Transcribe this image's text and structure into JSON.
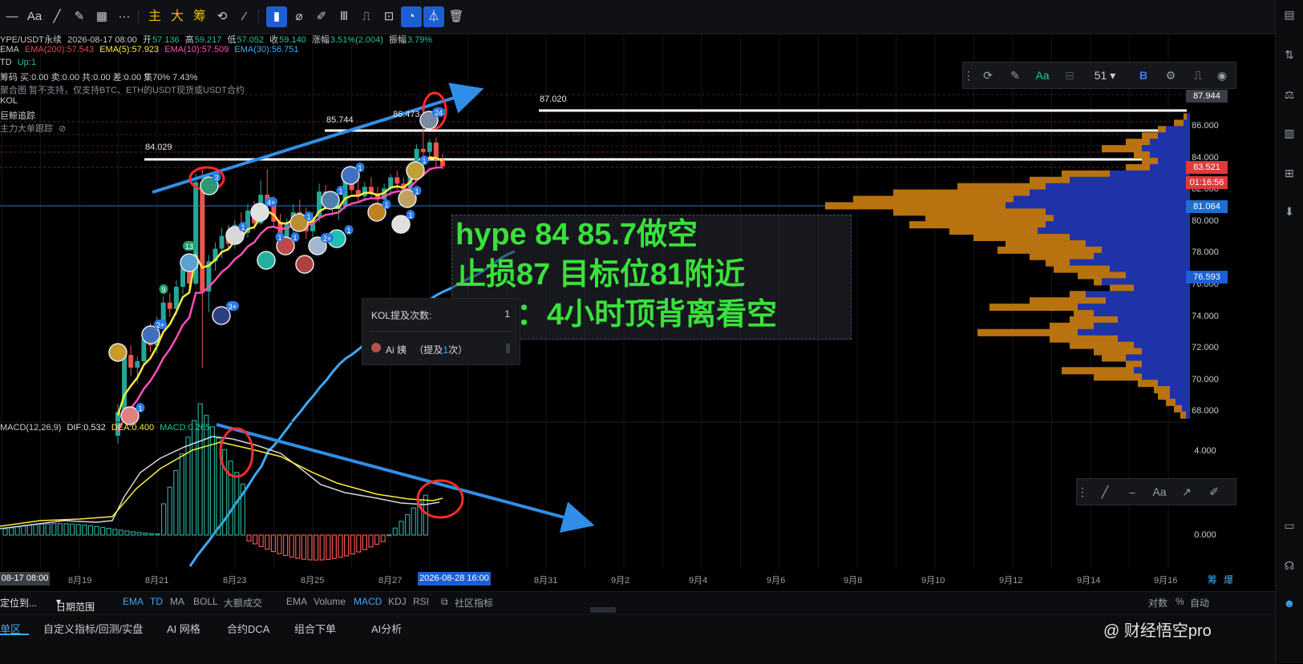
{
  "toolbar": {
    "items": [
      "一一",
      "Aa",
      "／",
      "✎",
      "▦",
      "···",
      "主",
      "大",
      "筹",
      "⟲",
      "⁄",
      "▮",
      "⌀",
      "✐",
      "Ⅲ",
      "⎍",
      "⊡",
      "◔",
      "⏃",
      "🗑"
    ],
    "text_aa": "Aa",
    "text_zhu": "主",
    "text_da": "大",
    "text_chou": "筹"
  },
  "legend": {
    "symbol": "YPE/USDT永续",
    "datetime": "2026-08-17 08:00",
    "open_label": "开",
    "open": "57.136",
    "high_label": "高",
    "high": "59.217",
    "low_label": "低",
    "low": "57.052",
    "close_label": "收",
    "close": "59.140",
    "change_label": "涨幅",
    "change": "3.51%(2.004)",
    "amp_label": "振幅",
    "amp": "3.79%",
    "ema_title": "EMA",
    "ema200": "EMA(200):57.543",
    "ema5": "EMA(5):57.923",
    "ema10": "EMA(10):57.509",
    "ema30": "EMA(30):56.751",
    "td_title": "TD",
    "td_value": "Up:1",
    "chip_line": "筹码 买:0.00 卖:0.00 共:0.00 差:0.00 集70% 7.43%",
    "chip_buy": "0.00",
    "chip_sell": "0.00",
    "chip_total": "0.00",
    "chip_diff": "0.00",
    "chip_conc": "7.43%",
    "merge_note": "聚合图 暂不支持，仅支持BTC、ETH的USDT现货或USDT合约",
    "kol": "KOL",
    "whale": "巨鲸追踪",
    "bigorder": "主力大单跟踪"
  },
  "chart_labels": {
    "l1": "84.029",
    "l2": "85.744",
    "l3": "87.020",
    "l4": "86.473"
  },
  "badges": [
    "3",
    "13",
    "9",
    "2+",
    "1",
    "1",
    "4+",
    "1",
    "1",
    "1",
    "2+",
    "1",
    "1",
    "1",
    "1",
    "1",
    "1",
    "1",
    "24",
    "3+"
  ],
  "annotation": {
    "line1": "hype 84  85.7做空",
    "line2": "止损87   目标位81附近",
    "line3": "理由：4小时顶背离看空"
  },
  "kol_popup": {
    "title": "KOL提及次数:",
    "count": "1",
    "user": "Ai 姨",
    "detail_prefix": "（提及",
    "detail_num": "1",
    "detail_suffix": "次）"
  },
  "float_toolbar": {
    "num": "51",
    "b": "B",
    "aa": "Aa"
  },
  "lower_toolbar": {
    "aa": "Aa"
  },
  "price_axis": {
    "ticks": [
      "86.000",
      "84.000",
      "82.000",
      "80.000",
      "78.000",
      "76.000",
      "74.000",
      "72.000",
      "70.000",
      "68.000"
    ],
    "pills": [
      {
        "text": "87.944",
        "color": "#3a3d44"
      },
      {
        "text": "83.521",
        "color": "#e03a3e"
      },
      {
        "text": "01:16:56",
        "color": "#e03a3e"
      },
      {
        "text": "81.064",
        "color": "#1f6fd1"
      },
      {
        "text": "76.593",
        "color": "#1c5fd4"
      }
    ],
    "plus": "+"
  },
  "macd": {
    "title": "MACD(12,26,9)",
    "dif": "DIF:0.532",
    "dea": "DEA:0.400",
    "macd": "MACD:0.265",
    "ticks": [
      "4.000",
      "0.000"
    ]
  },
  "date_axis": {
    "ticks": [
      "8月19",
      "8月21",
      "8月23",
      "8月25",
      "8月27",
      "8月31",
      "9月2",
      "9月4",
      "9月6",
      "9月8",
      "9月10",
      "9月12",
      "9月14",
      "9月16"
    ],
    "left_badge": "08-17 08:00",
    "cursor": "2026-08-28 16:00",
    "right_a": "筹",
    "right_b": "爆"
  },
  "bottom_bar": {
    "locate": "定位到...",
    "range": "日期范围",
    "ind_main": [
      "EMA",
      "TD",
      "MA",
      "BOLL",
      "大额成交"
    ],
    "ind_sub": [
      "EMA",
      "Volume",
      "MACD",
      "KDJ",
      "RSI"
    ],
    "community": "社区指标",
    "right": [
      "对数",
      "%",
      "自动"
    ]
  },
  "bottom_tabs": [
    "单区",
    "自定义指标/回测/实盘",
    "AI 网格",
    "合约DCA",
    "组合下单",
    "AI分析"
  ],
  "watermark": "@ 财经悟空pro",
  "colors": {
    "up": "#26a69a",
    "down": "#ef5350",
    "ema5": "#ffeb3b",
    "ema10": "#ff4fb8",
    "ema30": "#3fa9f5",
    "annotation": "#39e13a",
    "accent": "#1c5fd4",
    "arrow": "#2f8fe8"
  }
}
